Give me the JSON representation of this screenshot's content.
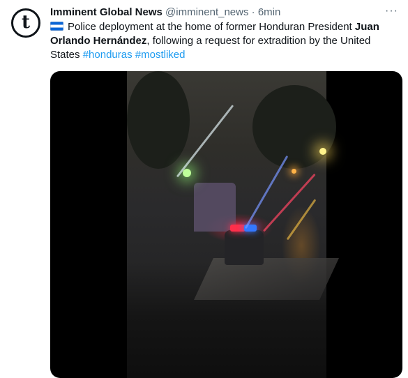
{
  "tweet": {
    "avatar_letter": "t",
    "author_name": "Imminent Global News",
    "handle": "@imminent_news",
    "separator": "·",
    "time": "6min",
    "more_label": "···",
    "text_part1": "Police deployment at the home of former Honduran President ",
    "text_bold": "Juan Orlando Hernández",
    "text_part2": ", following a request for extradition by the United States  ",
    "hashtags": [
      "#honduras",
      "#mostliked"
    ]
  },
  "colors": {
    "link": "#1d9bf0",
    "secondary_text": "#536471",
    "primary_text": "#0f1419"
  },
  "icons": {
    "flag": "honduras-flag-icon",
    "more": "more-options-icon"
  }
}
